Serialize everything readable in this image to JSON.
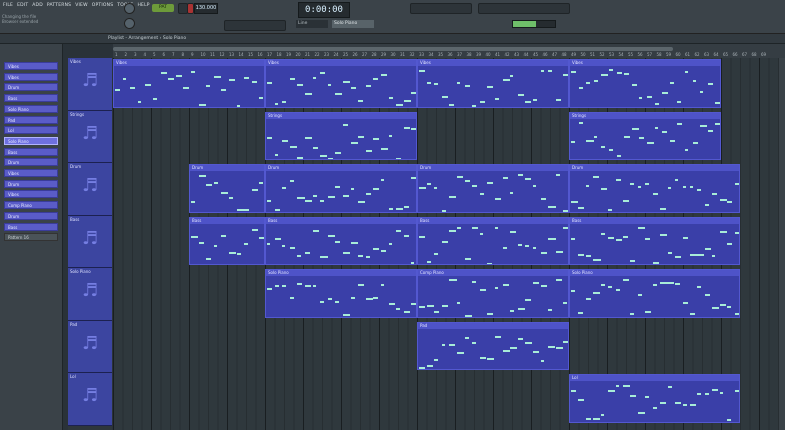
{
  "menu": [
    "FILE",
    "EDIT",
    "ADD",
    "PATTERNS",
    "VIEW",
    "OPTIONS",
    "TOOLS",
    "HELP"
  ],
  "hint": [
    "Changing the file",
    "Browser extended"
  ],
  "transport": {
    "pattern": "PAT",
    "tempo": "130.000",
    "time": "0:00:00"
  },
  "toolbar": {
    "mode": "Line",
    "channel": "Solo Piano"
  },
  "cpu": {
    "fraction": 0.55
  },
  "playlist": {
    "title": "Playlist - Arrangement › Solo Piano"
  },
  "patterns": [
    {
      "name": "Vibes"
    },
    {
      "name": "Vibes"
    },
    {
      "name": "Drum"
    },
    {
      "name": "Bass"
    },
    {
      "name": "Solo Piano"
    },
    {
      "name": "Pad"
    },
    {
      "name": "Lol"
    },
    {
      "name": "Solo Piano"
    },
    {
      "name": "Bass"
    },
    {
      "name": "Drum"
    },
    {
      "name": "Vibes"
    },
    {
      "name": "Drum"
    },
    {
      "name": "Vibes"
    },
    {
      "name": "Comp Piano"
    },
    {
      "name": "Drum"
    },
    {
      "name": "Bass"
    },
    {
      "name": "Pattern 16"
    }
  ],
  "selected_pattern": 7,
  "tracks": [
    {
      "name": "Vibes",
      "icon": "♬"
    },
    {
      "name": "Strings",
      "icon": "♬"
    },
    {
      "name": "Drum",
      "icon": "♬"
    },
    {
      "name": "Bass",
      "icon": "♬"
    },
    {
      "name": "Solo Piano",
      "icon": "♬"
    },
    {
      "name": "Pad",
      "icon": "♬"
    },
    {
      "name": "Lol",
      "icon": "♬"
    }
  ],
  "ruler": [
    "1",
    "2",
    "3",
    "4",
    "5",
    "6",
    "7",
    "8",
    "9",
    "10",
    "11",
    "12",
    "13",
    "14",
    "15",
    "16",
    "17",
    "18",
    "19",
    "20",
    "21",
    "22",
    "23",
    "24",
    "25",
    "26",
    "27",
    "28",
    "29",
    "30",
    "31",
    "32",
    "33",
    "34",
    "35",
    "36",
    "37",
    "38",
    "39",
    "40",
    "41",
    "42",
    "43",
    "44",
    "45",
    "46",
    "47",
    "48",
    "49",
    "50",
    "51",
    "52",
    "53",
    "54",
    "55",
    "56",
    "57",
    "58",
    "59",
    "60",
    "61",
    "62",
    "63",
    "64",
    "65",
    "66",
    "67",
    "68",
    "69"
  ],
  "clips": [
    {
      "track": 0,
      "start": 0,
      "len": 4,
      "label": "Vibes"
    },
    {
      "track": 0,
      "start": 4,
      "len": 4,
      "label": "Vibes"
    },
    {
      "track": 0,
      "start": 8,
      "len": 4,
      "label": "Vibes"
    },
    {
      "track": 0,
      "start": 12,
      "len": 4,
      "label": "Vibes"
    },
    {
      "track": 1,
      "start": 4,
      "len": 4,
      "label": "Strings"
    },
    {
      "track": 1,
      "start": 12,
      "len": 4,
      "label": "Strings"
    },
    {
      "track": 2,
      "start": 2,
      "len": 2,
      "label": "Drum"
    },
    {
      "track": 2,
      "start": 4,
      "len": 4,
      "label": "Drum"
    },
    {
      "track": 2,
      "start": 8,
      "len": 4,
      "label": "Drum"
    },
    {
      "track": 2,
      "start": 12,
      "len": 4.5,
      "label": "Drum"
    },
    {
      "track": 3,
      "start": 2,
      "len": 2,
      "label": "Bass"
    },
    {
      "track": 3,
      "start": 4,
      "len": 4,
      "label": "Bass"
    },
    {
      "track": 3,
      "start": 8,
      "len": 4,
      "label": "Bass"
    },
    {
      "track": 3,
      "start": 12,
      "len": 4.5,
      "label": "Bass"
    },
    {
      "track": 4,
      "start": 4,
      "len": 4,
      "label": "Solo Piano"
    },
    {
      "track": 4,
      "start": 8,
      "len": 4,
      "label": "Comp Piano"
    },
    {
      "track": 4,
      "start": 12,
      "len": 4.5,
      "label": "Solo Piano"
    },
    {
      "track": 5,
      "start": 8,
      "len": 4,
      "label": "Pad"
    },
    {
      "track": 6,
      "start": 12,
      "len": 4.5,
      "label": "Lol"
    }
  ]
}
